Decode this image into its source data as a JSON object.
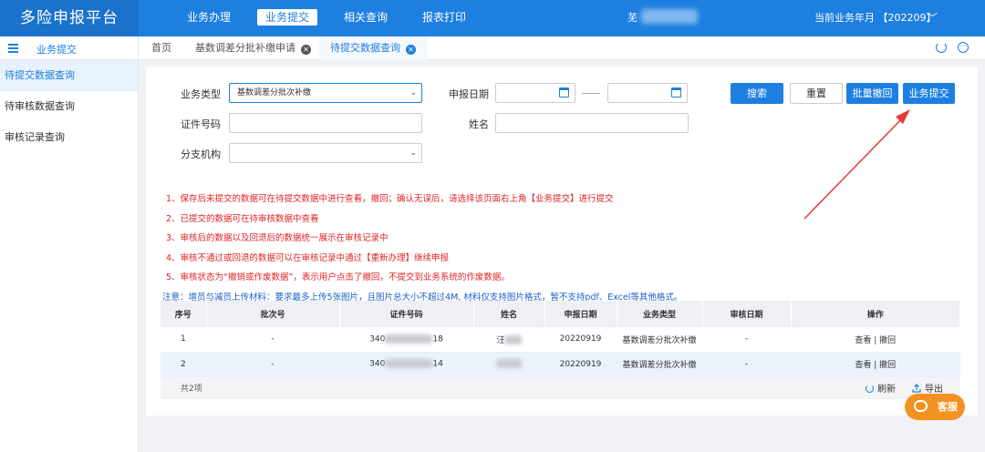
{
  "app": {
    "title": "多险申报平台"
  },
  "topnav": {
    "items": [
      {
        "label": "业务办理",
        "active": false
      },
      {
        "label": "业务提交",
        "active": true
      },
      {
        "label": "相关查询",
        "active": false
      },
      {
        "label": "报表打印",
        "active": false
      }
    ],
    "user_prefix": "芜",
    "period_label": "当前业务年月 【202209】",
    "period_caret": "﹀"
  },
  "sidebar": {
    "title": "业务提交",
    "items": [
      {
        "label": "待提交数据查询",
        "active": true
      },
      {
        "label": "待审核数据查询",
        "active": false
      },
      {
        "label": "审核记录查询",
        "active": false
      }
    ]
  },
  "tabs": [
    {
      "label": "首页"
    },
    {
      "label": "基数调差分批补缴申请"
    },
    {
      "label": "待提交数据查询"
    }
  ],
  "form": {
    "biz_type_label": "业务类型",
    "biz_type_value": "基数调差分批次补缴",
    "apply_date_label": "申报日期",
    "id_label": "证件号码",
    "name_label": "姓名",
    "branch_label": "分支机构"
  },
  "buttons": {
    "search": "搜索",
    "reset": "重置",
    "batch_withdraw": "批量撤回",
    "submit": "业务提交"
  },
  "notes": [
    "1、保存后未提交的数据可在待提交数据中进行查看，撤回；确认无误后，请选择该页面右上角【业务提交】进行提交",
    "2、已提交的数据可在待审核数据中查看",
    "3、审核后的数据以及回退后的数据统一展示在审核记录中",
    "4、审核不通过或回退的数据可以在审核记录中通过【重新办理】继续申报",
    "5、审核状态为“撤销或作废数据”，表示用户点击了撤回，不提交到业务系统的作废数据。"
  ],
  "note_blue": "注意：增员与减员上传材料：要求最多上传5张图片，且图片总大小不超过4M, 材料仅支持图片格式，暂不支持pdf、Excel等其他格式。",
  "table": {
    "headers": [
      "序号",
      "批次号",
      "证件号码",
      "姓名",
      "申报日期",
      "业务类型",
      "审核日期",
      "操作"
    ],
    "rows": [
      {
        "no": "1",
        "batch": "-",
        "id_prefix": "340",
        "id_suffix": "18",
        "name": "汪",
        "date": "20220919",
        "type": "基数调差分批次补缴",
        "audit": "-",
        "op_view": "查看",
        "op_sep": "|",
        "op_withdraw": "撤回"
      },
      {
        "no": "2",
        "batch": "-",
        "id_prefix": "340",
        "id_suffix": "14",
        "name": "",
        "date": "20220919",
        "type": "基数调差分批次补缴",
        "audit": "-",
        "op_view": "查看",
        "op_sep": "|",
        "op_withdraw": "撤回"
      }
    ],
    "footer": "共2项"
  },
  "tools": {
    "refresh": "刷新",
    "export": "导出"
  },
  "service": {
    "label": "客服"
  },
  "colors": {
    "primary": "#1d7fe0",
    "warning": "#e02424",
    "accent": "#f39220"
  }
}
